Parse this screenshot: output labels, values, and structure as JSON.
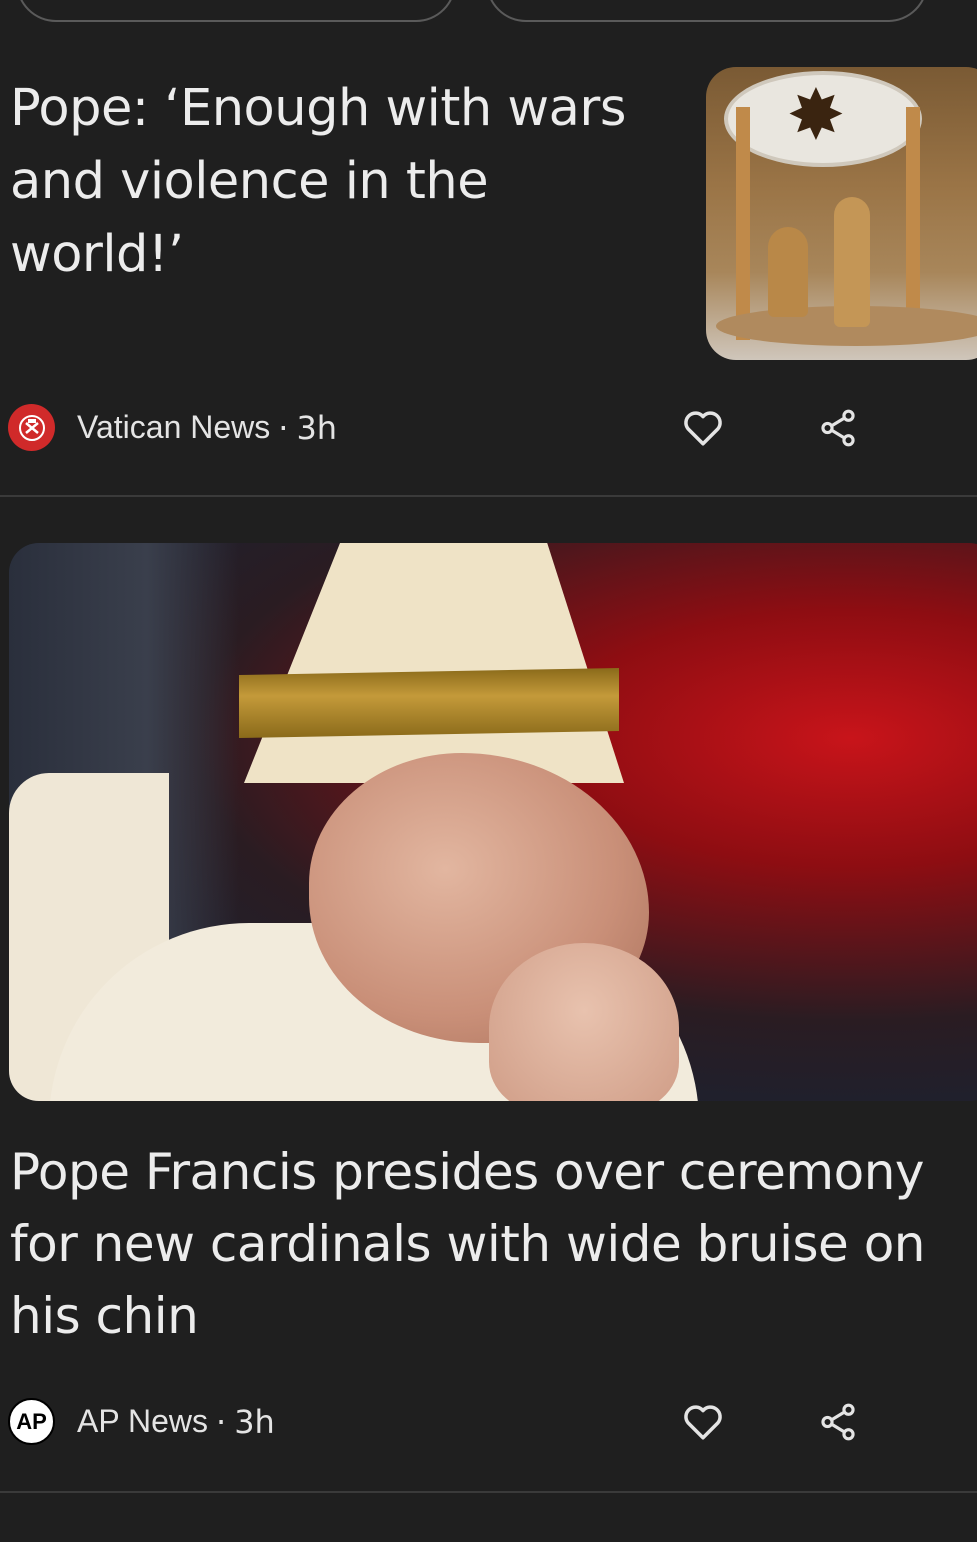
{
  "articles": [
    {
      "headline": "Pope: ‘Enough with wars and violence in the world!’",
      "source": "Vatican News",
      "age": "3h",
      "thumbnail": "nativity scene photo"
    },
    {
      "headline": "Pope Francis presides over ceremony for new cardinals with wide bruise on his chin",
      "source": "AP News",
      "age": "3h",
      "logo_text": "AP",
      "image": "Pope Francis photo"
    }
  ],
  "separator": "·",
  "icons": {
    "like": "heart-icon",
    "share": "share-icon",
    "more": "more-vert-icon",
    "vatican_logo": "vatican-emblem-icon"
  },
  "colors": {
    "background": "#1f1f1f",
    "text": "#ececec",
    "divider": "#3a3a3a",
    "vatican_red": "#d02a2a"
  }
}
